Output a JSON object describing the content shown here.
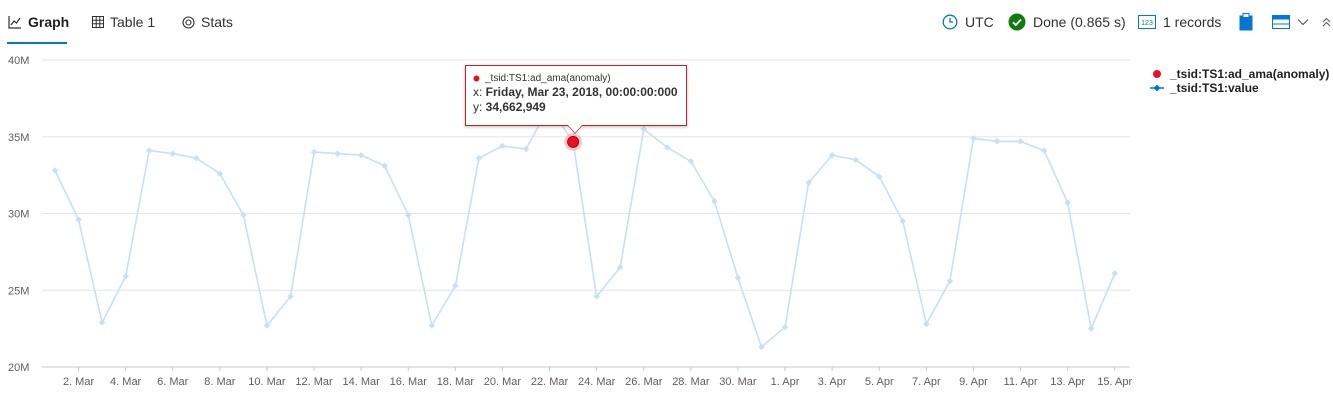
{
  "tabs": [
    {
      "label": "Graph",
      "icon": "line-chart-icon",
      "active": true
    },
    {
      "label": "Table 1",
      "icon": "table-icon",
      "active": false
    },
    {
      "label": "Stats",
      "icon": "stats-icon",
      "active": false
    }
  ],
  "status": {
    "timezone": "UTC",
    "done": "Done (0.865 s)",
    "records": "1 records",
    "records_icon_text": "123"
  },
  "colors": {
    "series_value": "#c7e0f4",
    "series_value_legend": "#0078d4",
    "anomaly": "#e81123",
    "done_badge": "#107c10",
    "accent": "#0078d4"
  },
  "legend": [
    {
      "name": "_tsid:TS1:ad_ama(anomaly)"
    },
    {
      "name": "_tsid:TS1:value"
    }
  ],
  "tooltip": {
    "series": "_tsid:TS1:ad_ama(anomaly)",
    "x_prefix": "x: ",
    "x_value": "Friday, Mar 23, 2018, 00:00:00:000",
    "y_prefix": "y: ",
    "y_value": "34,662,949"
  },
  "chart_data": {
    "type": "line",
    "x_start": "2018-03-01",
    "x_tick_labels": [
      "2. Mar",
      "4. Mar",
      "6. Mar",
      "8. Mar",
      "10. Mar",
      "12. Mar",
      "14. Mar",
      "16. Mar",
      "18. Mar",
      "20. Mar",
      "22. Mar",
      "24. Mar",
      "26. Mar",
      "28. Mar",
      "30. Mar",
      "1. Apr",
      "3. Apr",
      "5. Apr",
      "7. Apr",
      "9. Apr",
      "11. Apr",
      "13. Apr",
      "15. Apr"
    ],
    "y_tick_labels": [
      "20M",
      "25M",
      "30M",
      "35M",
      "40M"
    ],
    "y_ticks": [
      20000000,
      25000000,
      30000000,
      35000000,
      40000000
    ],
    "ylim": [
      20000000,
      40000000
    ],
    "grid": true,
    "legend_position": "right",
    "series": [
      {
        "name": "_tsid:TS1:value",
        "values": [
          32.8,
          29.6,
          22.9,
          25.9,
          34.1,
          33.9,
          33.6,
          32.6,
          29.9,
          22.7,
          24.6,
          34.0,
          33.9,
          33.8,
          33.1,
          29.9,
          22.7,
          25.3,
          33.6,
          34.4,
          34.2,
          37.0,
          34.66,
          24.6,
          26.5,
          35.5,
          34.3,
          33.4,
          30.8,
          25.8,
          21.3,
          22.6,
          32.0,
          33.8,
          33.5,
          32.4,
          29.5,
          22.8,
          25.6,
          34.9,
          34.7,
          34.7,
          34.1,
          30.7,
          22.5,
          26.1
        ]
      },
      {
        "name": "_tsid:TS1:ad_ama(anomaly)",
        "points": [
          {
            "x": "2018-03-23",
            "y": 34662949
          }
        ]
      }
    ]
  }
}
